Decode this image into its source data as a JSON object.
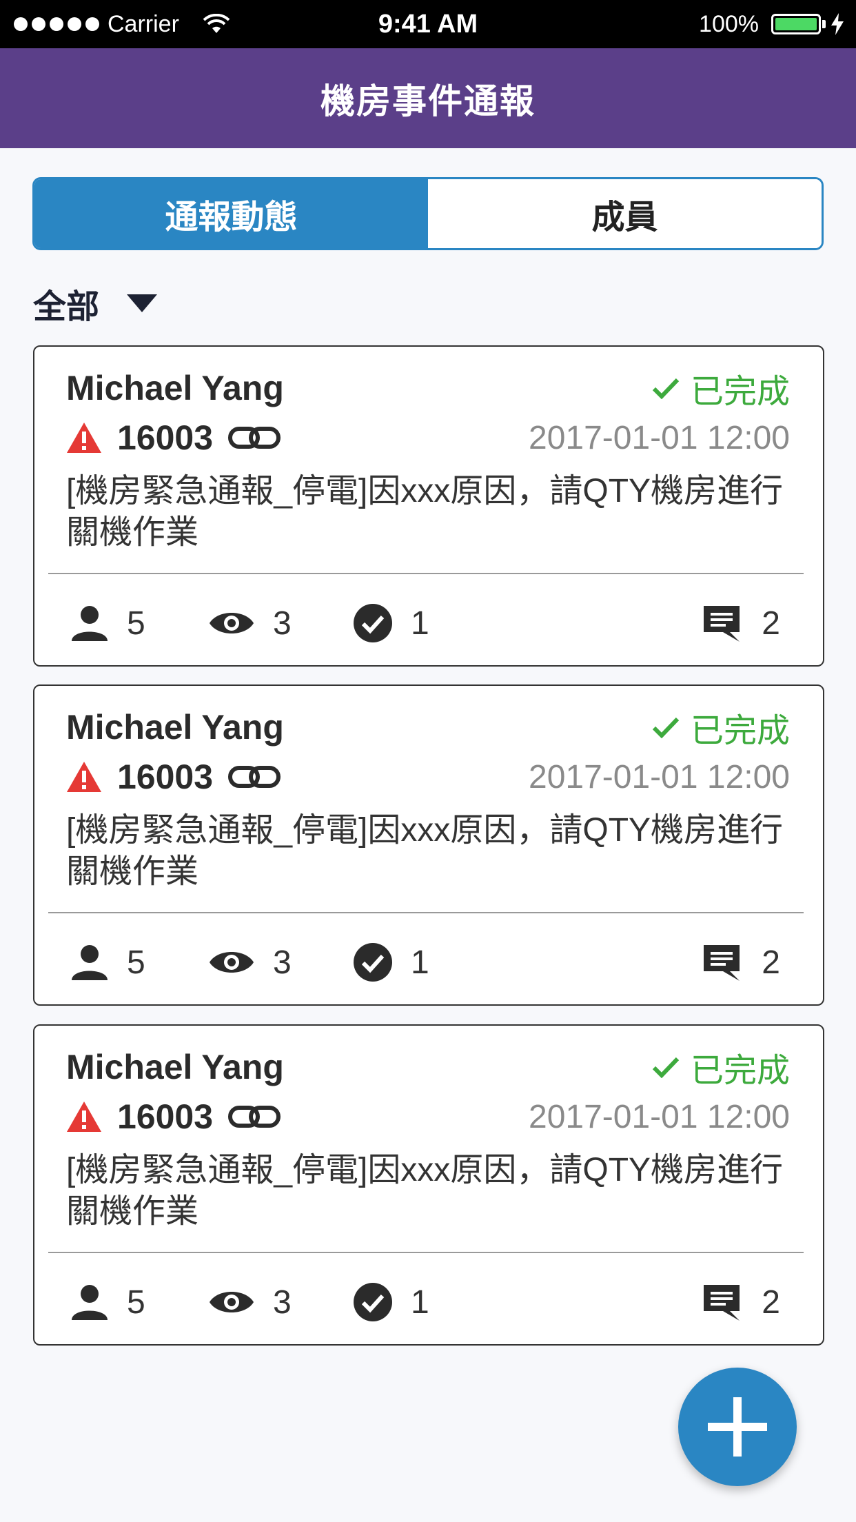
{
  "status_bar": {
    "carrier": "Carrier",
    "time": "9:41 AM",
    "battery_percent": "100%",
    "battery_level": 1.0
  },
  "nav": {
    "title": "機房事件通報"
  },
  "tabs": [
    {
      "label": "通報動態",
      "active": true
    },
    {
      "label": "成員",
      "active": false
    }
  ],
  "filter": {
    "label": "全部",
    "icon": "caret-down-icon"
  },
  "cards": [
    {
      "author": "Michael Yang",
      "status": "已完成",
      "event_id": "16003",
      "timestamp": "2017-01-01 12:00",
      "message": "[機房緊急通報_停電]因xxx原因，請QTY機房進行關機作業",
      "members": "5",
      "views": "3",
      "done": "1",
      "comments": "2"
    },
    {
      "author": "Michael Yang",
      "status": "已完成",
      "event_id": "16003",
      "timestamp": "2017-01-01 12:00",
      "message": "[機房緊急通報_停電]因xxx原因，請QTY機房進行關機作業",
      "members": "5",
      "views": "3",
      "done": "1",
      "comments": "2"
    },
    {
      "author": "Michael Yang",
      "status": "已完成",
      "event_id": "16003",
      "timestamp": "2017-01-01 12:00",
      "message": "[機房緊急通報_停電]因xxx原因，請QTY機房進行關機作業",
      "members": "5",
      "views": "3",
      "done": "1",
      "comments": "2"
    }
  ],
  "colors": {
    "nav_bg": "#5b3f89",
    "accent": "#2a86c3",
    "status_done": "#3daa3d",
    "warning": "#e53935"
  },
  "icons": [
    "wifi-icon",
    "battery-icon",
    "charging-icon",
    "caret-down-icon",
    "check-icon",
    "warning-icon",
    "link-icon",
    "person-icon",
    "eye-icon",
    "check-circle-icon",
    "comment-icon",
    "plus-icon"
  ]
}
